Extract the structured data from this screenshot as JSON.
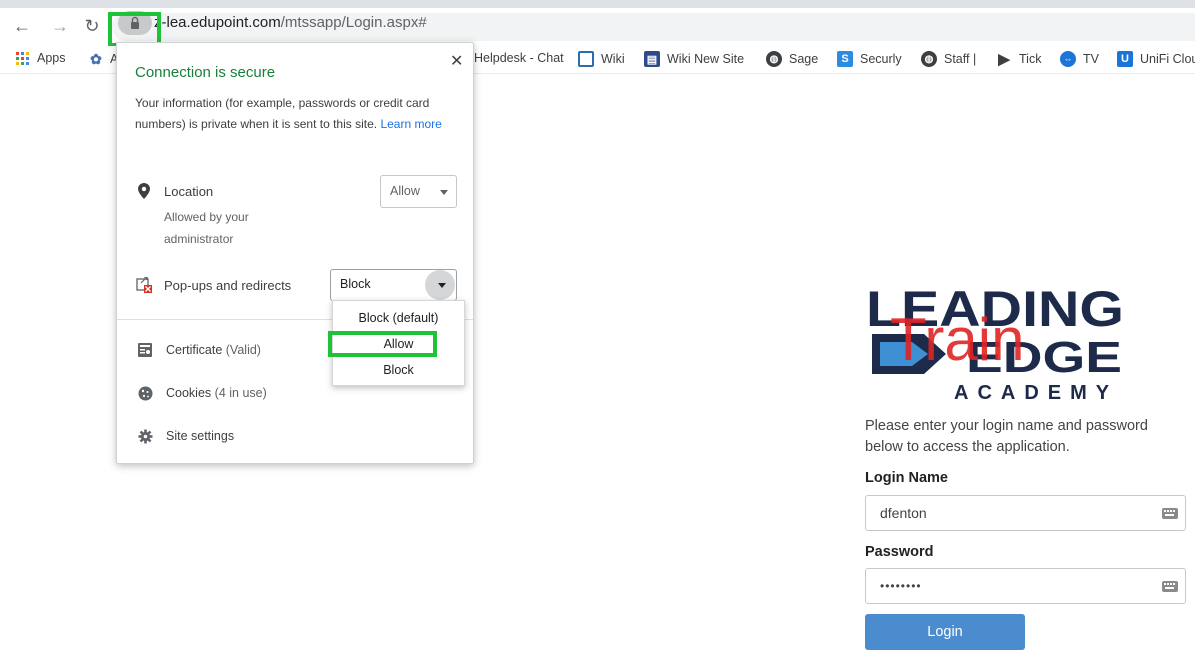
{
  "browser": {
    "url_host": "z-lea.edupoint.com",
    "url_path": "/mtssapp/Login.aspx#"
  },
  "bookmarks": [
    {
      "label": "Apps",
      "icon": "apps-grid-icon"
    },
    {
      "label": "A",
      "icon": "gear-puzzle-icon"
    },
    {
      "label": "Helpdesk - Chat",
      "icon": "none"
    },
    {
      "label": "Wiki",
      "icon": "wiki-icon"
    },
    {
      "label": "Wiki New Site",
      "icon": "wiki-new-icon"
    },
    {
      "label": "Sage",
      "icon": "globe-icon"
    },
    {
      "label": "Securly",
      "icon": "securly-icon"
    },
    {
      "label": "Staff |",
      "icon": "globe-icon"
    },
    {
      "label": "Tick",
      "icon": "tick-icon"
    },
    {
      "label": "TV",
      "icon": "teamviewer-icon"
    },
    {
      "label": "UniFi Clou",
      "icon": "unifi-icon"
    }
  ],
  "site_info": {
    "title": "Connection is secure",
    "description": "Your information (for example, passwords or credit card numbers) is private when it is sent to this site.",
    "learn_more": "Learn more",
    "location": {
      "label": "Location",
      "sub": "Allowed by your administrator",
      "value": "Allow"
    },
    "popups": {
      "label": "Pop-ups and redirects",
      "value": "Block",
      "options": [
        "Block (default)",
        "Allow",
        "Block"
      ]
    },
    "certificate": {
      "label": "Certificate",
      "status": "(Valid)"
    },
    "cookies": {
      "label": "Cookies",
      "status": "(4 in use)"
    },
    "site_settings": "Site settings",
    "close_symbol": "✕"
  },
  "login": {
    "logo_line1": "LEADING",
    "logo_line2": "EDGE",
    "logo_line3": "ACADEMY",
    "logo_overlay": "Train",
    "description": "Please enter your login name and password below to access the application.",
    "login_name_label": "Login Name",
    "login_name_value": "dfenton",
    "password_label": "Password",
    "password_value": "••••••••",
    "button_label": "Login"
  },
  "colors": {
    "secure_green": "#188038",
    "highlight_green": "#1ec337",
    "login_blue": "#4a8cce",
    "logo_navy": "#1e2a4a",
    "overlay_red": "#e02424"
  }
}
